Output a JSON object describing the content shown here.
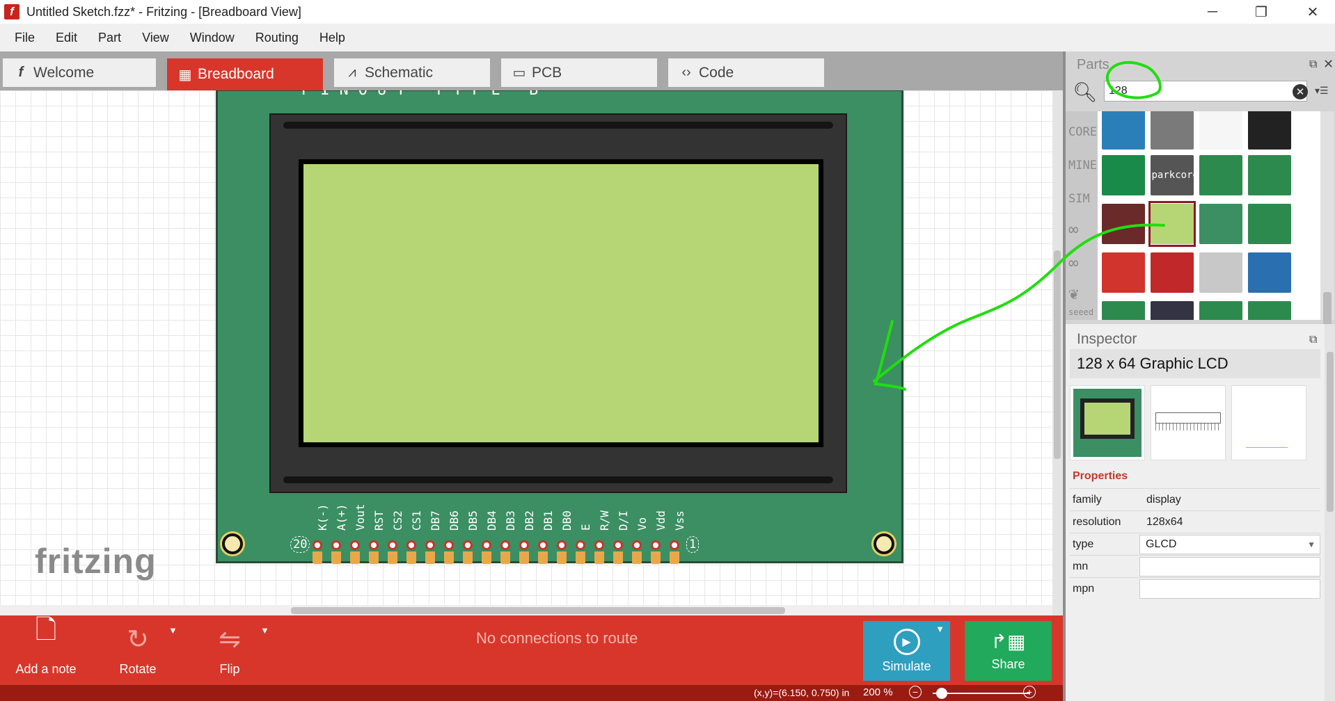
{
  "window": {
    "title": "Untitled Sketch.fzz* - Fritzing - [Breadboard View]",
    "minimize_icon": "─",
    "maximize_icon": "❐",
    "close_icon": "✕"
  },
  "menu": [
    "File",
    "Edit",
    "Part",
    "View",
    "Window",
    "Routing",
    "Help"
  ],
  "tabs": [
    {
      "label": "Welcome",
      "icon": "fritzing-f-icon",
      "glyph": "f"
    },
    {
      "label": "Breadboard",
      "icon": "breadboard-icon",
      "glyph": "▦",
      "active": true
    },
    {
      "label": "Schematic",
      "icon": "resistor-icon",
      "glyph": "⩘"
    },
    {
      "label": "PCB",
      "icon": "pcb-icon",
      "glyph": "▭"
    },
    {
      "label": "Code",
      "icon": "code-icon",
      "glyph": "‹›"
    }
  ],
  "canvas": {
    "watermark": "fritzing",
    "top_label_fragment": "PINOUT TYPE B"
  },
  "lcd_pins": {
    "labels": [
      "K(-)",
      "A(+)",
      "Vout",
      "RST",
      "CS2",
      "CS1",
      "DB7",
      "DB6",
      "DB5",
      "DB4",
      "DB3",
      "DB2",
      "DB1",
      "DB0",
      "E",
      "R/W",
      "D/I",
      "Vo",
      "Vdd",
      "Vss"
    ],
    "left_number": "20",
    "right_number": "1"
  },
  "bottom_toolbar": {
    "add_note": "Add a note",
    "rotate": "Rotate",
    "flip": "Flip",
    "status": "No connections to route",
    "simulate": "Simulate",
    "share": "Share",
    "dropdown_glyph": "▼"
  },
  "status_bar": {
    "coords": "(x,y)=(6.150, 0.750) in",
    "zoom": "200 %",
    "zoom_out": "−",
    "zoom_in": "+"
  },
  "parts": {
    "title": "Parts",
    "search_value": "128",
    "bins": [
      "CORE",
      "MINE",
      "SIM"
    ],
    "icons": {
      "search": "search-icon",
      "clear": "clear-icon"
    }
  },
  "inspector": {
    "title": "Inspector",
    "part_name": "128 x 64 Graphic LCD",
    "properties_label": "Properties",
    "properties": [
      {
        "key": "family",
        "value": "display"
      },
      {
        "key": "resolution",
        "value": "128x64"
      },
      {
        "key": "type",
        "value": "GLCD"
      },
      {
        "key": "mn",
        "value": ""
      },
      {
        "key": "mpn",
        "value": ""
      }
    ]
  },
  "colors": {
    "accent": "#d8362a",
    "simulate": "#2e9fbf",
    "share": "#21a95c",
    "pcb": "#3b8f63",
    "lcd_screen": "#b6d675",
    "annotation": "#22dd11"
  }
}
